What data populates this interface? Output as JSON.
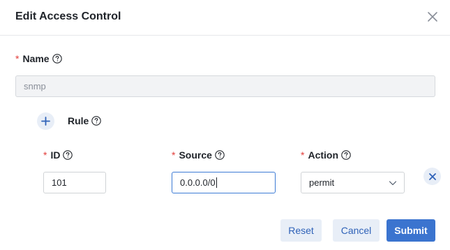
{
  "dialog": {
    "title": "Edit Access Control"
  },
  "name_field": {
    "required_mark": "*",
    "label": "Name",
    "value": "snmp"
  },
  "rule": {
    "label": "Rule"
  },
  "columns": {
    "id_label": "ID",
    "source_label": "Source",
    "action_label": "Action",
    "required_mark": "*"
  },
  "rule_row": {
    "id_value": "101",
    "source_value": "0.0.0.0/0",
    "action_value": "permit"
  },
  "footer": {
    "reset_label": "Reset",
    "cancel_label": "Cancel",
    "submit_label": "Submit"
  },
  "icons": {
    "close": "close-icon",
    "help": "question-circle-icon",
    "add": "plus-icon",
    "remove": "close-circle-icon",
    "dropdown": "chevron-down-icon"
  },
  "colors": {
    "required": "#e23c39",
    "primary": "#3b74cf",
    "secondary_bg": "#e8eef7",
    "secondary_text": "#2f62b8",
    "focus_border": "#3d7bd5"
  }
}
